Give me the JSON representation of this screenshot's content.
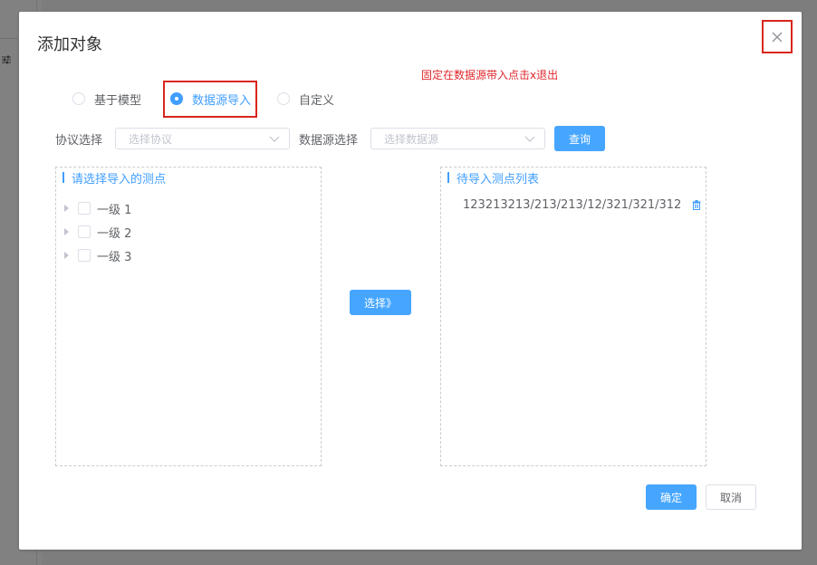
{
  "dialog": {
    "title": "添加对象",
    "annotation": "固定在数据源带入点击x退出"
  },
  "radios": [
    {
      "label": "基于模型",
      "checked": false
    },
    {
      "label": "数据源导入",
      "checked": true
    },
    {
      "label": "自定义",
      "checked": false
    }
  ],
  "filters": {
    "protocol_label": "协议选择",
    "protocol_placeholder": "选择协议",
    "source_label": "数据源选择",
    "source_placeholder": "选择数据源",
    "query_button": "查询"
  },
  "left_panel": {
    "title": "请选择导入的测点",
    "nodes": [
      "一级 1",
      "一级 2",
      "一级 3"
    ]
  },
  "select_button": "选择》",
  "right_panel": {
    "title": "待导入测点列表",
    "items": [
      "123213213/213/213/12/321/321/312"
    ]
  },
  "footer": {
    "ok": "确定",
    "cancel": "取消"
  },
  "icons": {
    "close": "close-icon",
    "chevron": "chevron-down-icon",
    "trash": "trash-icon",
    "filter": "filter-sliders-icon"
  },
  "colors": {
    "primary": "#409eff",
    "annotation": "#e0282e"
  }
}
